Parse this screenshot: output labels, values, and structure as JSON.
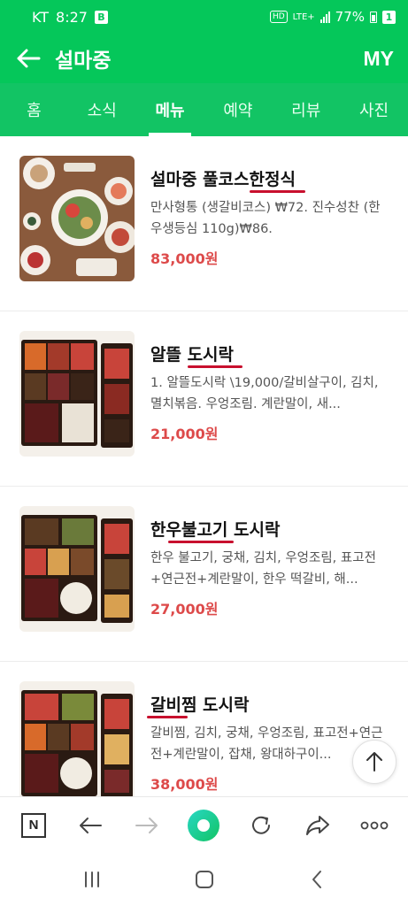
{
  "status_bar": {
    "carrier": "KT",
    "time": "8:27",
    "carrier_badge": "B",
    "hd": "HD",
    "network": "LTE+",
    "battery": "77%",
    "sim_badge": "1"
  },
  "header": {
    "title": "설마중",
    "my_label": "MY"
  },
  "tabs": [
    {
      "label": "홈",
      "active": false
    },
    {
      "label": "소식",
      "active": false
    },
    {
      "label": "메뉴",
      "active": true
    },
    {
      "label": "예약",
      "active": false
    },
    {
      "label": "리뷰",
      "active": false
    },
    {
      "label": "사진",
      "active": false
    }
  ],
  "menu": {
    "items": [
      {
        "name": "설마중 풀코스한정식",
        "description": "만사형통 (생갈비코스) ₩72. 진수성찬 (한우생등심 110g)₩86.",
        "price": "83,000원"
      },
      {
        "name": "알뜰 도시락",
        "description": "1. 알뜰도시락 \\19,000/갈비살구이, 김치, 멸치볶음. 우엉조림. 계란말이, 새...",
        "price": "21,000원"
      },
      {
        "name": "한우불고기 도시락",
        "description": "한우 불고기, 궁채, 김치, 우엉조림, 표고전+연근전+계란말이, 한우 떡갈비, 해...",
        "price": "27,000원"
      },
      {
        "name": "갈비찜 도시락",
        "description": "갈비찜, 김치, 궁채, 우엉조림, 표고전+연근전+계란말이, 잡채, 왕대하구이...",
        "price": "38,000원"
      }
    ]
  },
  "browser_bar": {
    "n_label": "N"
  },
  "colors": {
    "brand_green": "#05c75a",
    "tab_green": "#12c464",
    "price_red": "#dd4a4a",
    "underline_red": "#c8102e"
  }
}
